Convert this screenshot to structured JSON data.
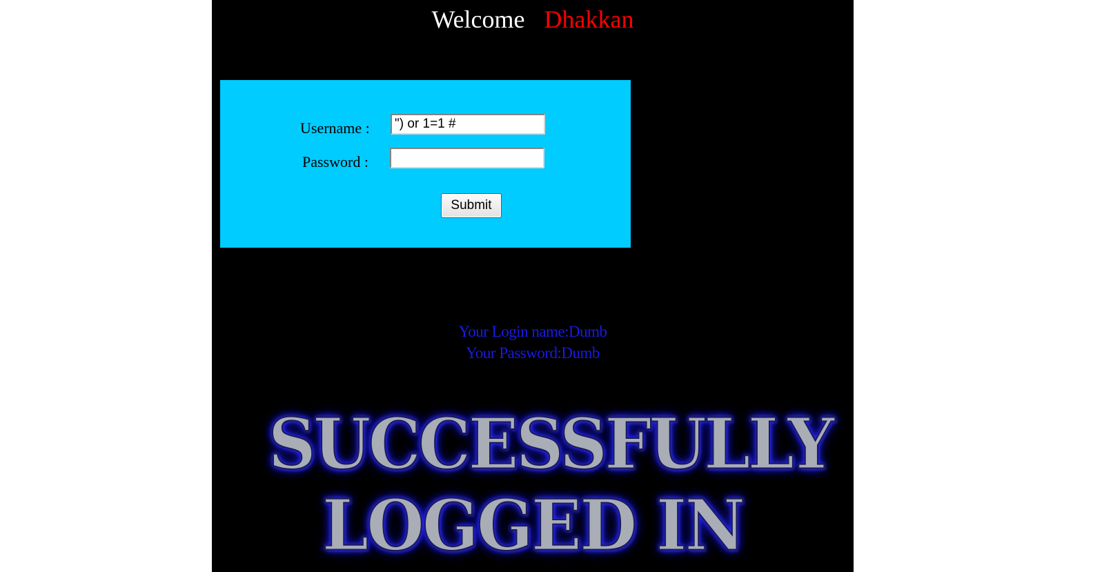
{
  "header": {
    "welcome_label": "Welcome",
    "username_display": "Dhakkan"
  },
  "login_form": {
    "username_label": "Username :",
    "password_label": "Password :",
    "username_value": "\") or 1=1 #",
    "password_value": "",
    "submit_label": "Submit"
  },
  "result": {
    "login_name_line": "Your Login name:Dumb",
    "password_line": "Your Password:Dumb"
  },
  "banner": {
    "line1": "SUCCESSFULLY",
    "line2": "LOGGED IN"
  },
  "colors": {
    "page_background": "#000000",
    "panel_background": "#00ccff",
    "welcome_text": "#ffffff",
    "username_accent": "#ff0000",
    "result_text": "#1a1ae6",
    "banner_glow": "#2020ff"
  }
}
